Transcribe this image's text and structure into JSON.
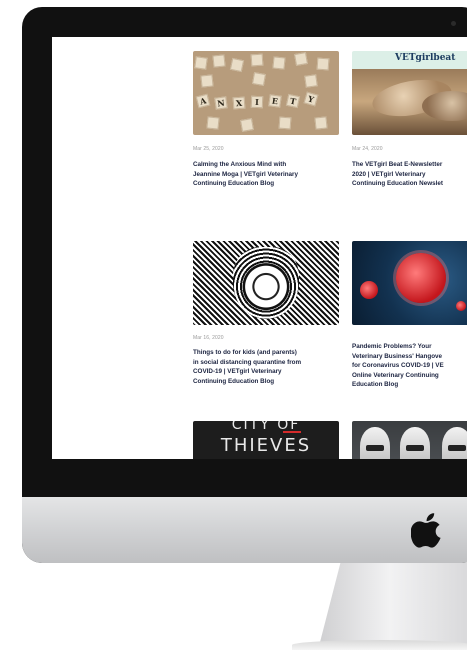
{
  "posts": [
    {
      "date": "Mar 25, 2020",
      "title_lines": [
        "Calming the Anxious Mind with",
        "Jeannine Moga | VETgirl Veterinary",
        "Continuing Education Blog"
      ]
    },
    {
      "date": "Mar 24, 2020",
      "title_lines": [
        "The VETgirl Beat E-Newsletter",
        "2020 | VETgirl Veterinary",
        "Continuing Education Newslet"
      ]
    },
    {
      "date": "Mar 16, 2020",
      "title_lines": [
        "Things to do for kids (and parents)",
        "in social distancing quarantine from",
        "COVID-19 | VETgirl Veterinary",
        "Continuing Education Blog"
      ]
    },
    {
      "date": "",
      "title_lines": [
        "Pandemic Problems? Your",
        "Veterinary Business' Hangove",
        "for Coronavirus COVID-19 | VE",
        "Online Veterinary Continuing",
        "Education Blog"
      ]
    }
  ],
  "thumbs": {
    "anxiety_letters": [
      "A",
      "N",
      "X",
      "I",
      "E",
      "T",
      "Y"
    ],
    "vetgirl_brand": "VETgirlbeat",
    "city_line1": "CITY OF",
    "city_line2": "THIEVES"
  },
  "colors": {
    "title": "#1b2340",
    "date": "#9a9a9a",
    "bezel": "#111111"
  },
  "icons": {
    "logo": "apple-logo-icon"
  }
}
